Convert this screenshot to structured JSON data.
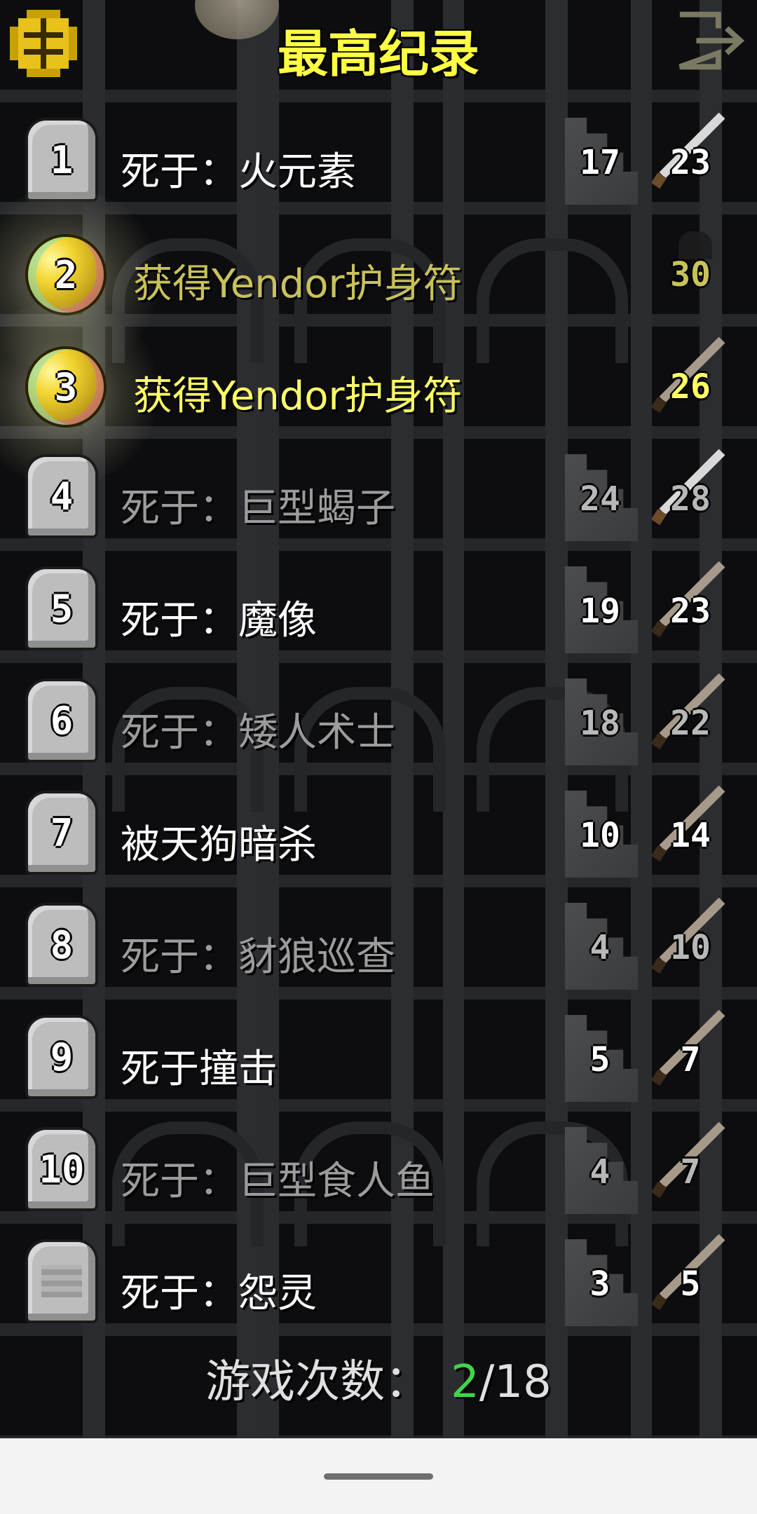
{
  "header": {
    "title": "最高纪录",
    "menu_icon": "menu-icon",
    "exit_icon": "exit-icon"
  },
  "records": [
    {
      "rank": "1",
      "description": "死于：火元素",
      "depth": "17",
      "level": "23",
      "style": "normal",
      "dim": false
    },
    {
      "rank": "2",
      "description": "获得Yendor护身符",
      "depth": "",
      "level": "30",
      "style": "winner",
      "dim": true
    },
    {
      "rank": "3",
      "description": "获得Yendor护身符",
      "depth": "",
      "level": "26",
      "style": "winner",
      "dim": false
    },
    {
      "rank": "4",
      "description": "死于：巨型蝎子",
      "depth": "24",
      "level": "28",
      "style": "normal",
      "dim": true
    },
    {
      "rank": "5",
      "description": "死于：魔像",
      "depth": "19",
      "level": "23",
      "style": "normal",
      "dim": false
    },
    {
      "rank": "6",
      "description": "死于：矮人术士",
      "depth": "18",
      "level": "22",
      "style": "normal",
      "dim": true
    },
    {
      "rank": "7",
      "description": "被天狗暗杀",
      "depth": "10",
      "level": "14",
      "style": "normal",
      "dim": false
    },
    {
      "rank": "8",
      "description": "死于：豺狼巡查",
      "depth": "4",
      "level": "10",
      "style": "normal",
      "dim": true
    },
    {
      "rank": "9",
      "description": "死于撞击",
      "depth": "5",
      "level": "7",
      "style": "normal",
      "dim": false
    },
    {
      "rank": "10",
      "description": "死于：巨型食人鱼",
      "depth": "4",
      "level": "7",
      "style": "normal",
      "dim": true
    },
    {
      "rank": "",
      "description": "死于：怨灵",
      "depth": "3",
      "level": "5",
      "style": "plain",
      "dim": false
    }
  ],
  "footer": {
    "label": "游戏次数：",
    "won": "2",
    "total": "/18"
  },
  "colors": {
    "title": "#ffff44",
    "winner_text": "#ffff66",
    "won_count": "#3fd64a",
    "background": "#0d0d0f"
  }
}
